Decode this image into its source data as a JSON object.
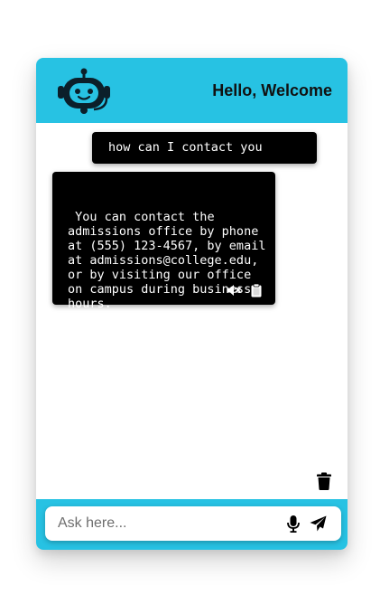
{
  "header": {
    "title": "Hello, Welcome",
    "logo_icon": "robot-icon",
    "background_color": "#27c2e3"
  },
  "messages": {
    "user": {
      "text": "how can I contact you"
    },
    "bot": {
      "text": " You can contact the admissions office by phone at (555) 123-4567, by email at admissions@college.edu, or by visiting our office on campus during business hours.",
      "mute_icon": "volume-mute-icon",
      "copy_icon": "clipboard-icon"
    }
  },
  "chat": {
    "clear_icon": "trash-icon"
  },
  "composer": {
    "placeholder": "Ask here...",
    "value": "",
    "mic_icon": "microphone-icon",
    "send_icon": "send-icon"
  },
  "colors": {
    "accent": "#27c2e3",
    "bubble_bg": "#000000",
    "bubble_text": "#ffffff"
  }
}
